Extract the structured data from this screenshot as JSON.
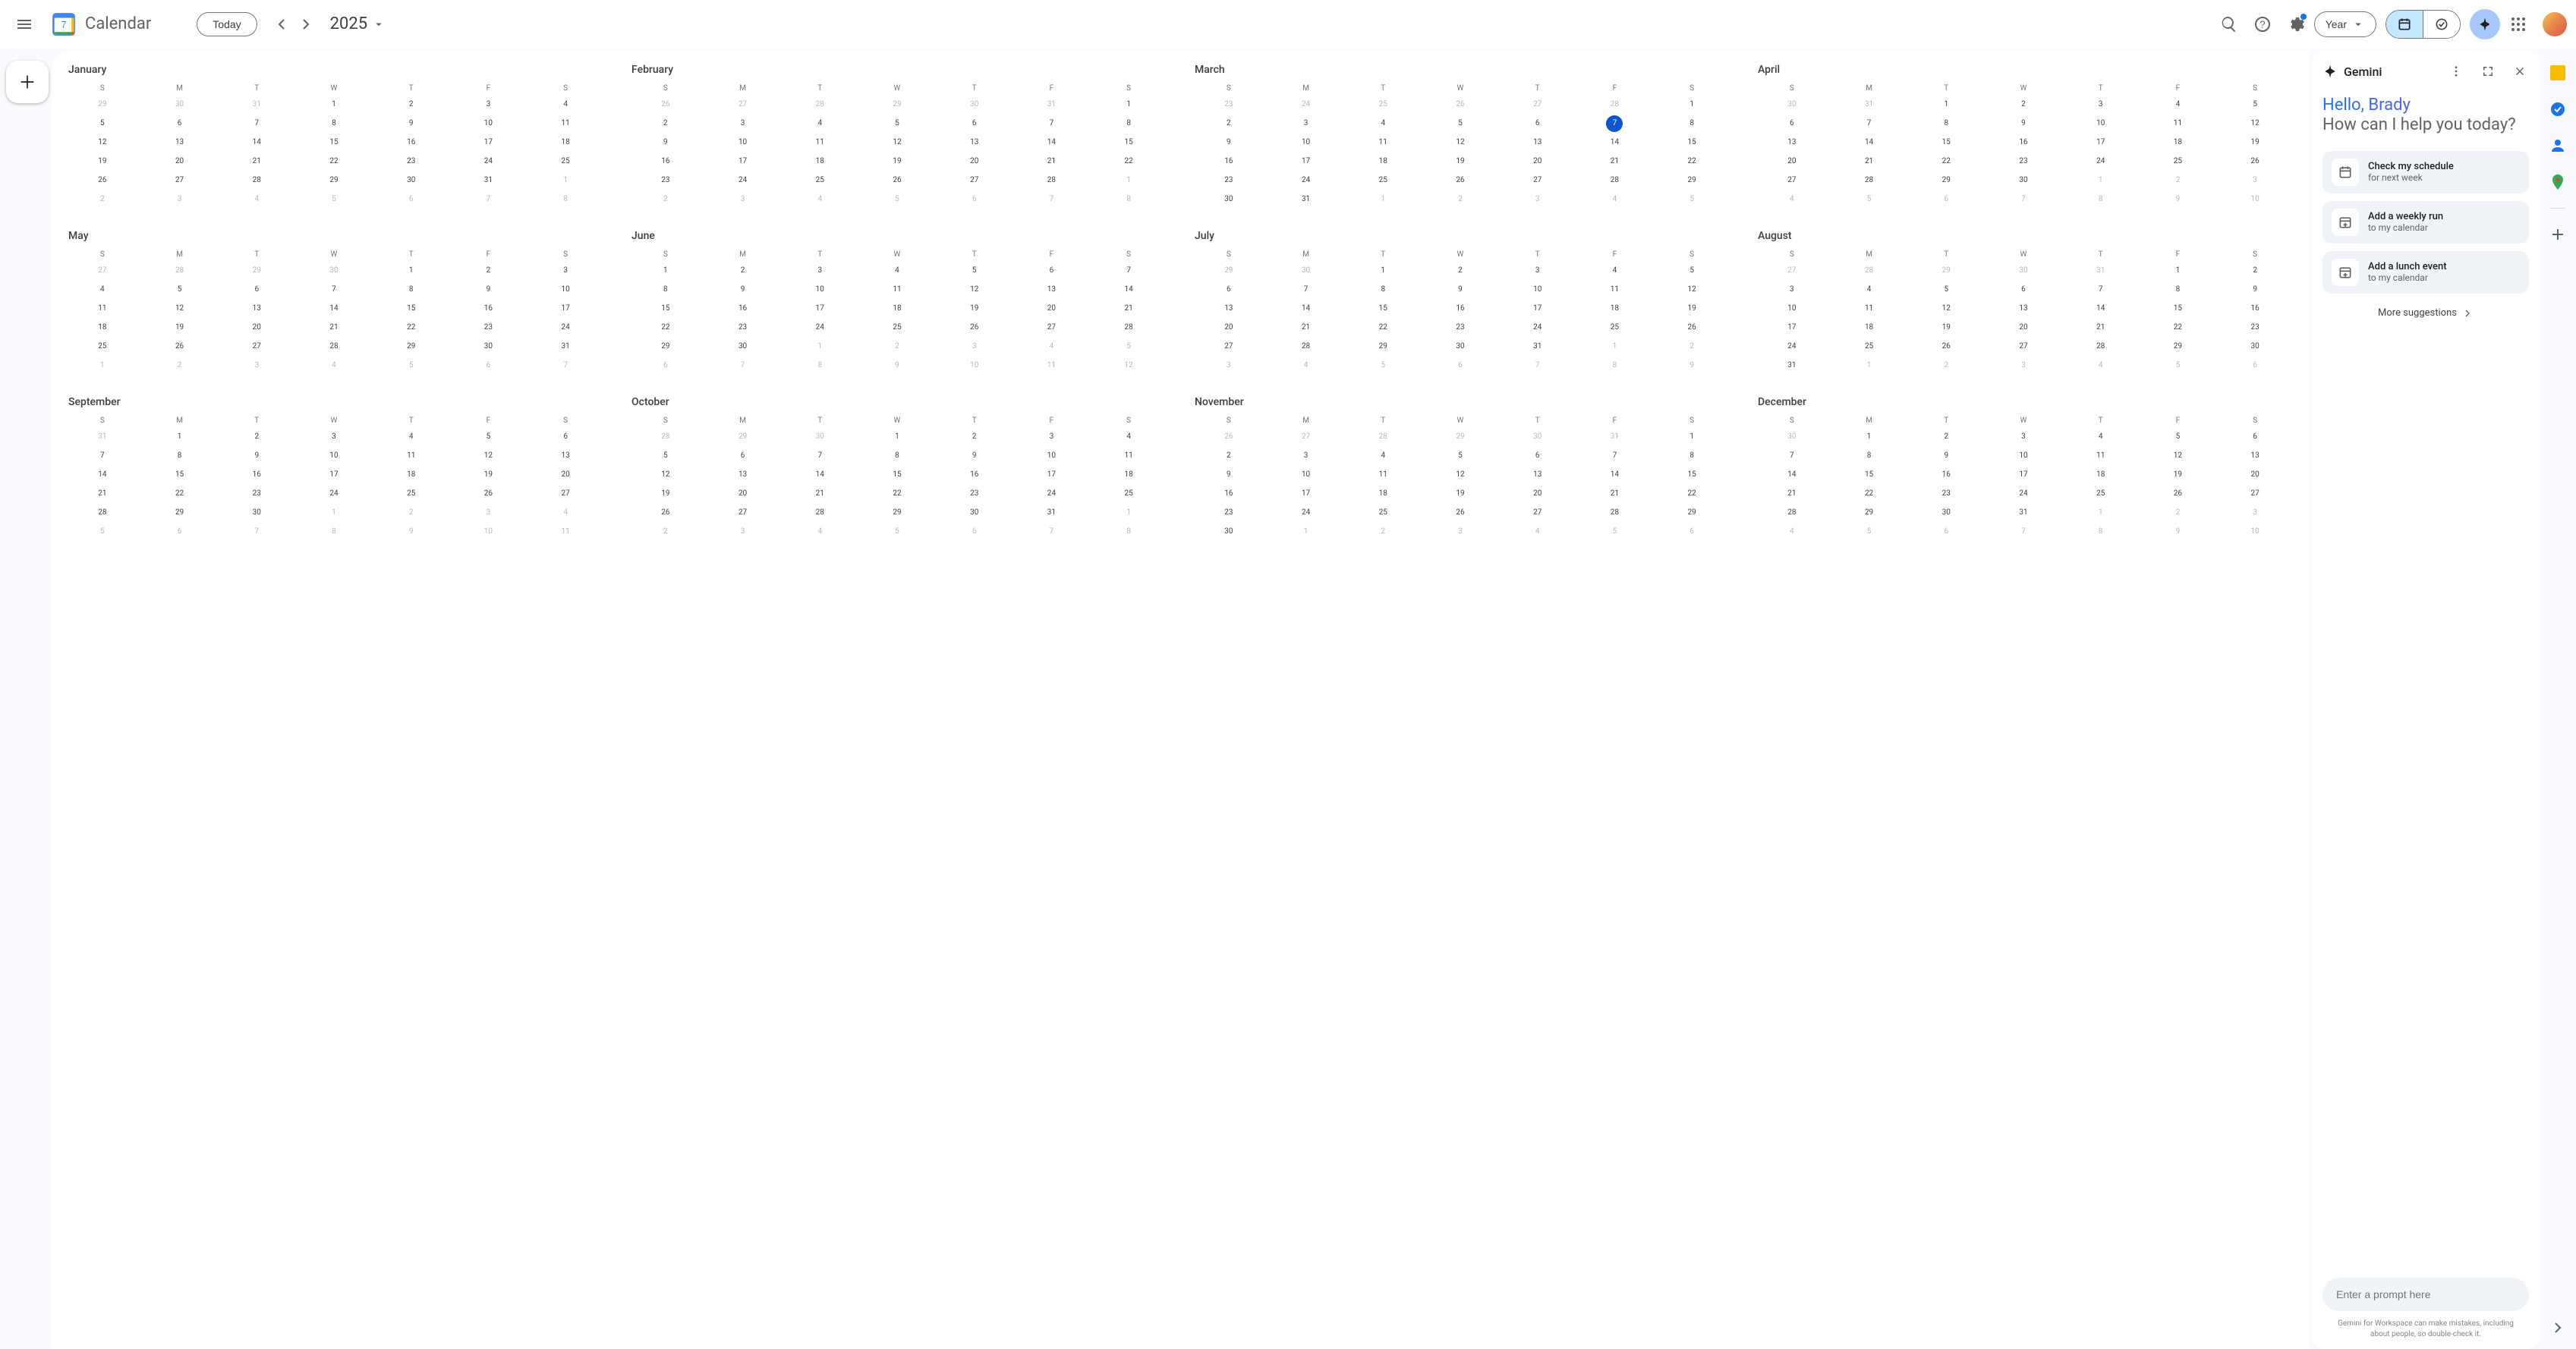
{
  "header": {
    "app_title": "Calendar",
    "logo_day": "7",
    "today_label": "Today",
    "year_label": "2025",
    "view_label": "Year"
  },
  "today": {
    "month_index": 2,
    "day": 7
  },
  "week_days": [
    "S",
    "M",
    "T",
    "W",
    "T",
    "F",
    "S"
  ],
  "months": [
    {
      "name": "January",
      "grid": [
        [
          29,
          30,
          31,
          1,
          2,
          3,
          4
        ],
        [
          5,
          6,
          7,
          8,
          9,
          10,
          11
        ],
        [
          12,
          13,
          14,
          15,
          16,
          17,
          18
        ],
        [
          19,
          20,
          21,
          22,
          23,
          24,
          25
        ],
        [
          26,
          27,
          28,
          29,
          30,
          31,
          1
        ],
        [
          2,
          3,
          4,
          5,
          6,
          7,
          8
        ]
      ],
      "first_in": 3,
      "last_in": 33
    },
    {
      "name": "February",
      "grid": [
        [
          26,
          27,
          28,
          29,
          30,
          31,
          1
        ],
        [
          2,
          3,
          4,
          5,
          6,
          7,
          8
        ],
        [
          9,
          10,
          11,
          12,
          13,
          14,
          15
        ],
        [
          16,
          17,
          18,
          19,
          20,
          21,
          22
        ],
        [
          23,
          24,
          25,
          26,
          27,
          28,
          1
        ],
        [
          2,
          3,
          4,
          5,
          6,
          7,
          8
        ]
      ],
      "first_in": 6,
      "last_in": 33
    },
    {
      "name": "March",
      "grid": [
        [
          23,
          24,
          25,
          26,
          27,
          28,
          1
        ],
        [
          2,
          3,
          4,
          5,
          6,
          7,
          8
        ],
        [
          9,
          10,
          11,
          12,
          13,
          14,
          15
        ],
        [
          16,
          17,
          18,
          19,
          20,
          21,
          22
        ],
        [
          23,
          24,
          25,
          26,
          27,
          28,
          29
        ],
        [
          30,
          31,
          1,
          2,
          3,
          4,
          5
        ]
      ],
      "first_in": 6,
      "last_in": 36
    },
    {
      "name": "April",
      "grid": [
        [
          30,
          31,
          1,
          2,
          3,
          4,
          5
        ],
        [
          6,
          7,
          8,
          9,
          10,
          11,
          12
        ],
        [
          13,
          14,
          15,
          16,
          17,
          18,
          19
        ],
        [
          20,
          21,
          22,
          23,
          24,
          25,
          26
        ],
        [
          27,
          28,
          29,
          30,
          1,
          2,
          3
        ],
        [
          4,
          5,
          6,
          7,
          8,
          9,
          10
        ]
      ],
      "first_in": 2,
      "last_in": 31
    },
    {
      "name": "May",
      "grid": [
        [
          27,
          28,
          29,
          30,
          1,
          2,
          3
        ],
        [
          4,
          5,
          6,
          7,
          8,
          9,
          10
        ],
        [
          11,
          12,
          13,
          14,
          15,
          16,
          17
        ],
        [
          18,
          19,
          20,
          21,
          22,
          23,
          24
        ],
        [
          25,
          26,
          27,
          28,
          29,
          30,
          31
        ],
        [
          1,
          2,
          3,
          4,
          5,
          6,
          7
        ]
      ],
      "first_in": 4,
      "last_in": 34
    },
    {
      "name": "June",
      "grid": [
        [
          1,
          2,
          3,
          4,
          5,
          6,
          7
        ],
        [
          8,
          9,
          10,
          11,
          12,
          13,
          14
        ],
        [
          15,
          16,
          17,
          18,
          19,
          20,
          21
        ],
        [
          22,
          23,
          24,
          25,
          26,
          27,
          28
        ],
        [
          29,
          30,
          1,
          2,
          3,
          4,
          5
        ],
        [
          6,
          7,
          8,
          9,
          10,
          11,
          12
        ]
      ],
      "first_in": 0,
      "last_in": 29
    },
    {
      "name": "July",
      "grid": [
        [
          29,
          30,
          1,
          2,
          3,
          4,
          5
        ],
        [
          6,
          7,
          8,
          9,
          10,
          11,
          12
        ],
        [
          13,
          14,
          15,
          16,
          17,
          18,
          19
        ],
        [
          20,
          21,
          22,
          23,
          24,
          25,
          26
        ],
        [
          27,
          28,
          29,
          30,
          31,
          1,
          2
        ],
        [
          3,
          4,
          5,
          6,
          7,
          8,
          9
        ]
      ],
      "first_in": 2,
      "last_in": 32
    },
    {
      "name": "August",
      "grid": [
        [
          27,
          28,
          29,
          30,
          31,
          1,
          2
        ],
        [
          3,
          4,
          5,
          6,
          7,
          8,
          9
        ],
        [
          10,
          11,
          12,
          13,
          14,
          15,
          16
        ],
        [
          17,
          18,
          19,
          20,
          21,
          22,
          23
        ],
        [
          24,
          25,
          26,
          27,
          28,
          29,
          30
        ],
        [
          31,
          1,
          2,
          3,
          4,
          5,
          6
        ]
      ],
      "first_in": 5,
      "last_in": 35
    },
    {
      "name": "September",
      "grid": [
        [
          31,
          1,
          2,
          3,
          4,
          5,
          6
        ],
        [
          7,
          8,
          9,
          10,
          11,
          12,
          13
        ],
        [
          14,
          15,
          16,
          17,
          18,
          19,
          20
        ],
        [
          21,
          22,
          23,
          24,
          25,
          26,
          27
        ],
        [
          28,
          29,
          30,
          1,
          2,
          3,
          4
        ],
        [
          5,
          6,
          7,
          8,
          9,
          10,
          11
        ]
      ],
      "first_in": 1,
      "last_in": 30
    },
    {
      "name": "October",
      "grid": [
        [
          28,
          29,
          30,
          1,
          2,
          3,
          4
        ],
        [
          5,
          6,
          7,
          8,
          9,
          10,
          11
        ],
        [
          12,
          13,
          14,
          15,
          16,
          17,
          18
        ],
        [
          19,
          20,
          21,
          22,
          23,
          24,
          25
        ],
        [
          26,
          27,
          28,
          29,
          30,
          31,
          1
        ],
        [
          2,
          3,
          4,
          5,
          6,
          7,
          8
        ]
      ],
      "first_in": 3,
      "last_in": 33
    },
    {
      "name": "November",
      "grid": [
        [
          26,
          27,
          28,
          29,
          30,
          31,
          1
        ],
        [
          2,
          3,
          4,
          5,
          6,
          7,
          8
        ],
        [
          9,
          10,
          11,
          12,
          13,
          14,
          15
        ],
        [
          16,
          17,
          18,
          19,
          20,
          21,
          22
        ],
        [
          23,
          24,
          25,
          26,
          27,
          28,
          29
        ],
        [
          30,
          1,
          2,
          3,
          4,
          5,
          6
        ]
      ],
      "first_in": 6,
      "last_in": 35
    },
    {
      "name": "December",
      "grid": [
        [
          30,
          1,
          2,
          3,
          4,
          5,
          6
        ],
        [
          7,
          8,
          9,
          10,
          11,
          12,
          13
        ],
        [
          14,
          15,
          16,
          17,
          18,
          19,
          20
        ],
        [
          21,
          22,
          23,
          24,
          25,
          26,
          27
        ],
        [
          28,
          29,
          30,
          31,
          1,
          2,
          3
        ],
        [
          4,
          5,
          6,
          7,
          8,
          9,
          10
        ]
      ],
      "first_in": 1,
      "last_in": 31
    }
  ],
  "gemini": {
    "title": "Gemini",
    "hello": "Hello, Brady",
    "subtitle": "How can I help you today?",
    "suggestions": [
      {
        "title": "Check my schedule",
        "sub": "for next week",
        "icon": "calendar"
      },
      {
        "title": "Add a weekly run",
        "sub": "to my calendar",
        "icon": "event-add"
      },
      {
        "title": "Add a lunch event",
        "sub": "to my calendar",
        "icon": "event-add"
      }
    ],
    "more": "More suggestions",
    "prompt_placeholder": "Enter a prompt here",
    "disclaimer": "Gemini for Workspace can make mistakes, including about people, so double-check it."
  },
  "right_rail": {
    "items": [
      "keep",
      "tasks",
      "contacts",
      "maps"
    ]
  }
}
